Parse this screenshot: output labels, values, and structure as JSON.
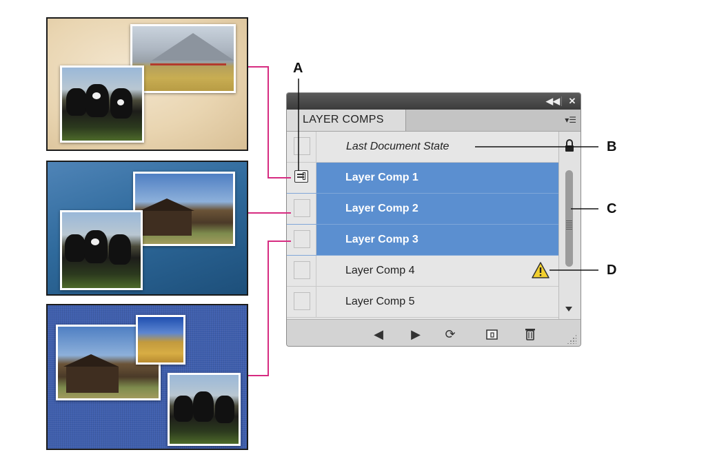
{
  "panel": {
    "title": "LAYER COMPS",
    "rows": [
      {
        "label": "Last Document State",
        "selected": false,
        "italic": true
      },
      {
        "label": "Layer Comp 1",
        "selected": true,
        "applied": true
      },
      {
        "label": "Layer Comp 2",
        "selected": true
      },
      {
        "label": "Layer Comp 3",
        "selected": true
      },
      {
        "label": "Layer Comp 4",
        "selected": false,
        "warning": true
      },
      {
        "label": "Layer Comp 5",
        "selected": false
      }
    ],
    "colors": {
      "selection": "#5b8fd0",
      "warning": "#f2d02e",
      "connector": "#d62a80"
    }
  },
  "callouts": {
    "a": "A",
    "b": "B",
    "c": "C",
    "d": "D"
  }
}
